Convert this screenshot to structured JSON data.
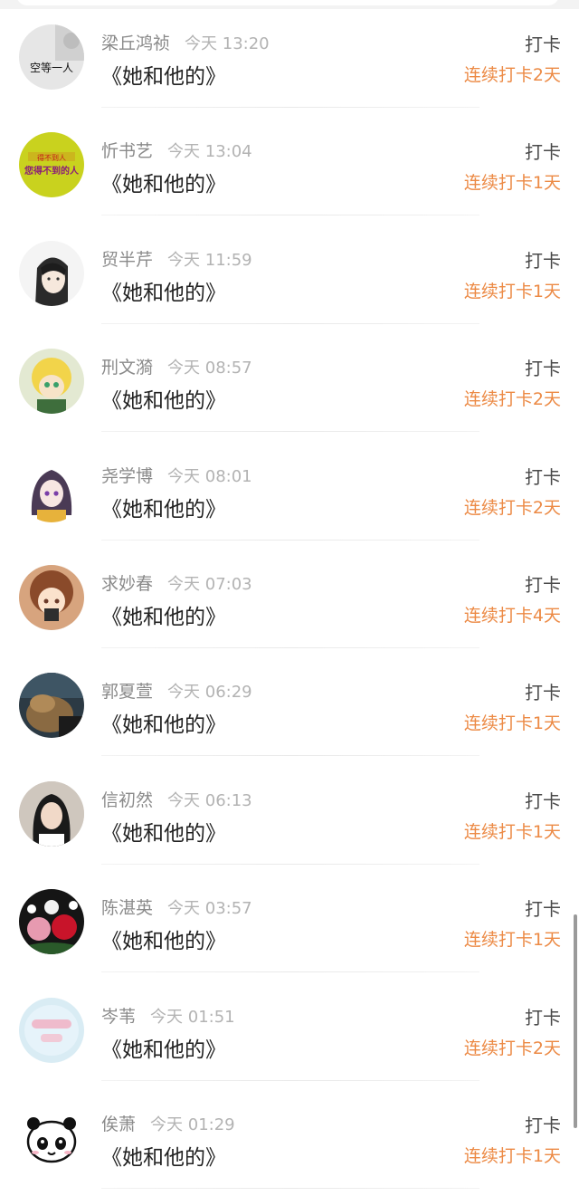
{
  "records": [
    {
      "name": "梁丘鸿祯",
      "time": "今天 13:20",
      "title": "《她和他的》",
      "action": "打卡",
      "streak": "连续打卡2天",
      "avatar": {
        "icon": "avatar-text-icon",
        "text": "空等一人",
        "bg": "#e6e6e6",
        "fg": "#111111"
      }
    },
    {
      "name": "忻书艺",
      "time": "今天 13:04",
      "title": "《她和他的》",
      "action": "打卡",
      "streak": "连续打卡1天",
      "avatar": {
        "icon": "avatar-text-icon",
        "top_text": "得不到人",
        "text": "您得不到的人",
        "bg": "#c9d21e",
        "fg": "#c51a1a"
      }
    },
    {
      "name": "贸半芹",
      "time": "今天 11:59",
      "title": "《她和他的》",
      "action": "打卡",
      "streak": "连续打卡1天",
      "avatar": {
        "icon": "avatar-anime-boy-icon",
        "bg": "#f4f4f4"
      }
    },
    {
      "name": "刑文漪",
      "time": "今天 08:57",
      "title": "《她和他的》",
      "action": "打卡",
      "streak": "连续打卡2天",
      "avatar": {
        "icon": "avatar-anime-yellow-icon",
        "bg": "#e3e9d2"
      }
    },
    {
      "name": "尧学博",
      "time": "今天 08:01",
      "title": "《她和他的》",
      "action": "打卡",
      "streak": "连续打卡2天",
      "avatar": {
        "icon": "avatar-anime-girl-icon",
        "bg": "#ffffff"
      }
    },
    {
      "name": "求妙春",
      "time": "今天 07:03",
      "title": "《她和他的》",
      "action": "打卡",
      "streak": "连续打卡4天",
      "avatar": {
        "icon": "avatar-anime-orange-icon",
        "bg": "#d7a47e"
      }
    },
    {
      "name": "郭夏萱",
      "time": "今天 06:29",
      "title": "《她和他的》",
      "action": "打卡",
      "streak": "连续打卡1天",
      "avatar": {
        "icon": "avatar-photo-dog-icon",
        "bg": "#2c3a44"
      }
    },
    {
      "name": "信初然",
      "time": "今天 06:13",
      "title": "《她和他的》",
      "action": "打卡",
      "streak": "连续打卡1天",
      "avatar": {
        "icon": "avatar-photo-girl-icon",
        "bg": "#dcd6cf"
      }
    },
    {
      "name": "陈湛英",
      "time": "今天 03:57",
      "title": "《她和他的》",
      "action": "打卡",
      "streak": "连续打卡1天",
      "avatar": {
        "icon": "avatar-roses-icon",
        "bg": "#151515"
      }
    },
    {
      "name": "岑苇",
      "time": "今天 01:51",
      "title": "《她和他的》",
      "action": "打卡",
      "streak": "连续打卡2天",
      "avatar": {
        "icon": "avatar-blurred-icon",
        "bg": "#d9ecf4"
      }
    },
    {
      "name": "俟萧",
      "time": "今天 01:29",
      "title": "《她和他的》",
      "action": "打卡",
      "streak": "连续打卡1天",
      "avatar": {
        "icon": "avatar-panda-icon",
        "bg": "#ffffff"
      }
    }
  ]
}
